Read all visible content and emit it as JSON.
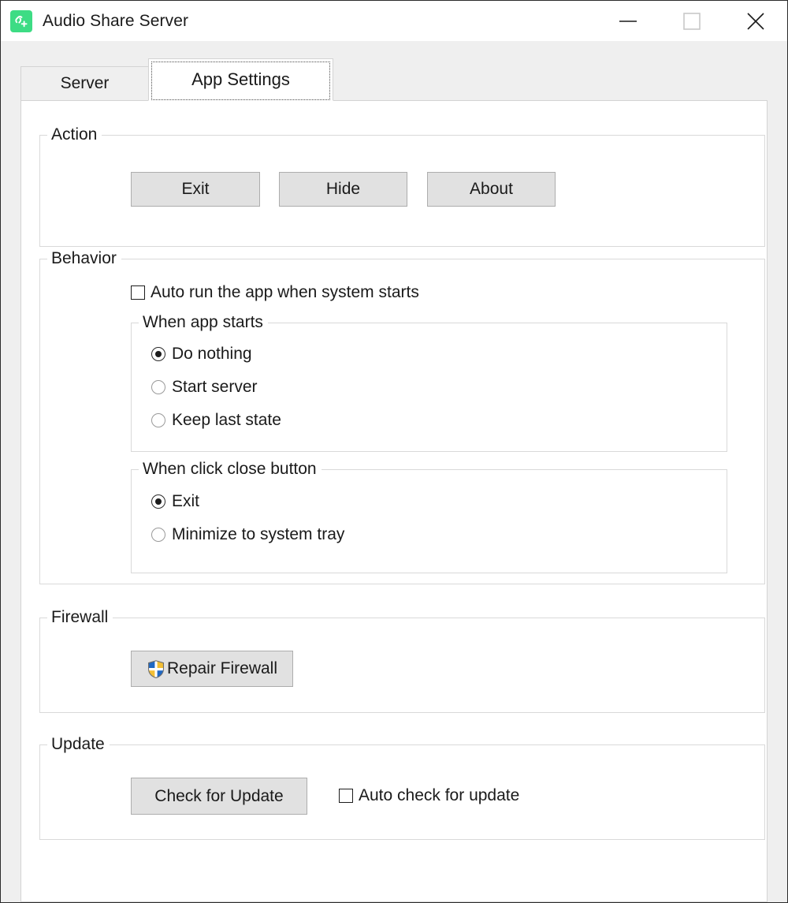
{
  "window": {
    "title": "Audio Share Server",
    "icon": "link-plus-icon",
    "accent_color": "#3ddc84",
    "controls": {
      "minimize": "minimize-icon",
      "maximize": "maximize-icon",
      "close": "close-icon"
    }
  },
  "tabs": [
    {
      "label": "Server",
      "active": false
    },
    {
      "label": "App Settings",
      "active": true
    }
  ],
  "groups": {
    "action": {
      "legend": "Action",
      "buttons": [
        {
          "label": "Exit"
        },
        {
          "label": "Hide"
        },
        {
          "label": "About"
        }
      ]
    },
    "behavior": {
      "legend": "Behavior",
      "autorun": {
        "label": "Auto run the app when system starts",
        "checked": false
      },
      "when_app_starts": {
        "legend": "When app starts",
        "options": [
          {
            "label": "Do nothing",
            "selected": true
          },
          {
            "label": "Start server",
            "selected": false
          },
          {
            "label": "Keep last state",
            "selected": false
          }
        ]
      },
      "when_close": {
        "legend": "When click close button",
        "options": [
          {
            "label": "Exit",
            "selected": true
          },
          {
            "label": "Minimize to system tray",
            "selected": false
          }
        ]
      }
    },
    "firewall": {
      "legend": "Firewall",
      "repair_button": {
        "label": "Repair Firewall",
        "icon": "uac-shield-icon"
      }
    },
    "update": {
      "legend": "Update",
      "check_button": {
        "label": "Check for Update"
      },
      "auto_check": {
        "label": "Auto check for update",
        "checked": false
      }
    }
  }
}
